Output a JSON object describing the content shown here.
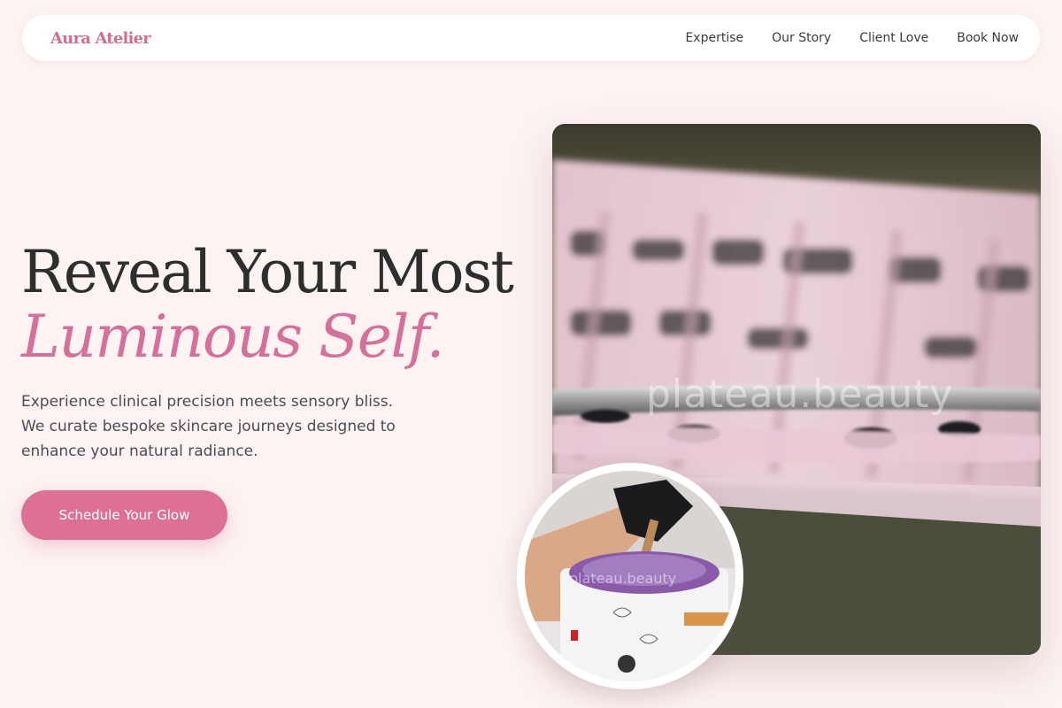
{
  "brand": {
    "name": "Aura Atelier",
    "accent": "#d46e91"
  },
  "nav": {
    "links": [
      {
        "label": "Expertise"
      },
      {
        "label": "Our Story"
      },
      {
        "label": "Client Love"
      },
      {
        "label": "Book Now"
      }
    ]
  },
  "hero": {
    "headline_line1": "Reveal Your Most",
    "headline_line2": "Luminous Self.",
    "subtext": "Experience clinical precision meets sensory bliss. We curate bespoke skincare journeys designed to enhance your natural radiance.",
    "cta_label": "Schedule Your Glow"
  },
  "images": {
    "main_watermark": "plateau.beauty",
    "circle_watermark": "plateau.beauty"
  },
  "colors": {
    "background": "#fdf3f3",
    "cta": "#dc7195",
    "headline_dark": "#2e2e2e"
  }
}
